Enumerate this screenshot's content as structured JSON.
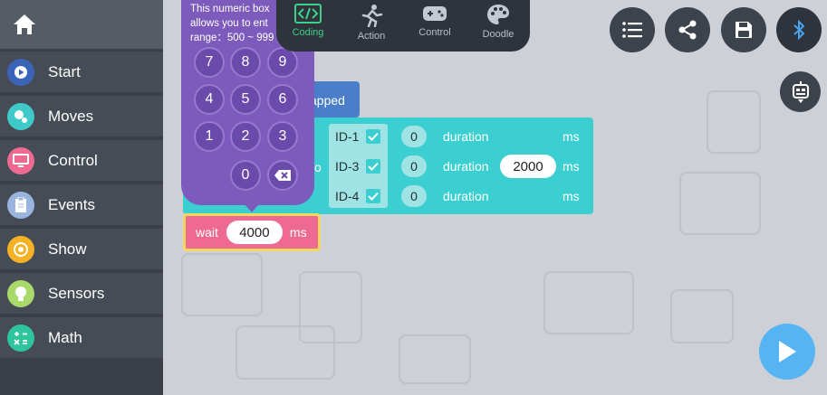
{
  "sidebar": {
    "home_icon": "home-icon",
    "items": [
      {
        "label": "Start",
        "icon": "play-circle-icon",
        "color": "#3b63b8"
      },
      {
        "label": "Moves",
        "icon": "moves-icon",
        "color": "#40c9c9"
      },
      {
        "label": "Control",
        "icon": "monitor-icon",
        "color": "#ee6a92"
      },
      {
        "label": "Events",
        "icon": "clipboard-icon",
        "color": "#9ab4e0"
      },
      {
        "label": "Show",
        "icon": "show-icon",
        "color": "#f4b224"
      },
      {
        "label": "Sensors",
        "icon": "bulb-icon",
        "color": "#a9d96b"
      },
      {
        "label": "Math",
        "icon": "math-icon",
        "color": "#2fc59c"
      }
    ]
  },
  "tabs": [
    {
      "label": "Coding",
      "icon": "code-icon",
      "active": true
    },
    {
      "label": "Action",
      "icon": "running-icon",
      "active": false
    },
    {
      "label": "Control",
      "icon": "gamepad-icon",
      "active": false
    },
    {
      "label": "Doodle",
      "icon": "palette-icon",
      "active": false
    }
  ],
  "toolbar": {
    "list_icon": "list-icon",
    "share_icon": "share-icon",
    "save_icon": "save-icon",
    "bluetooth_icon": "bluetooth-icon",
    "robot_icon": "robot-icon"
  },
  "keypad": {
    "hint_line1": "This numeric box",
    "hint_line2": "allows you to ent",
    "hint_line3": "range：500 ~ 999",
    "keys": [
      "7",
      "8",
      "9",
      "4",
      "5",
      "6",
      "1",
      "2",
      "3",
      "0"
    ],
    "backspace_icon": "backspace-icon"
  },
  "blocks": {
    "tapped_fragment": "apped",
    "servo_fragment": "vo",
    "servo_rows": [
      {
        "id": "ID-1",
        "value": "0",
        "duration_label": "duration",
        "duration": "",
        "unit": "ms"
      },
      {
        "id": "ID-3",
        "value": "0",
        "duration_label": "duration",
        "duration": "2000",
        "unit": "ms"
      },
      {
        "id": "ID-4",
        "value": "0",
        "duration_label": "duration",
        "duration": "",
        "unit": "ms"
      }
    ],
    "wait": {
      "label": "wait",
      "value": "4000",
      "unit": "ms"
    }
  },
  "play_icon": "play-icon",
  "colors": {
    "accent_green": "#3bd18a",
    "servo_teal": "#3ccfd2",
    "wait_pink": "#ee6a92",
    "keypad_purple": "#7c5bbd",
    "play_blue": "#56b4f2"
  }
}
